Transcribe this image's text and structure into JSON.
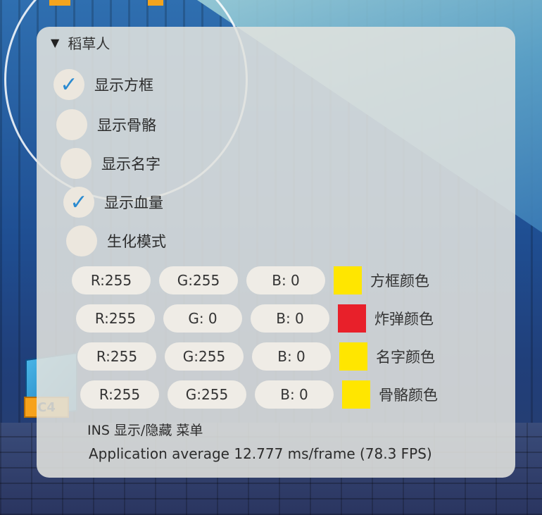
{
  "background": {
    "bomb_site_label": "C4"
  },
  "menu": {
    "header": {
      "toggle_glyph": "▼",
      "title": "稻草人"
    },
    "checkboxes": [
      {
        "label": "显示方框",
        "checked": true,
        "check_glyph": "✓"
      },
      {
        "label": "显示骨骼",
        "checked": false,
        "check_glyph": ""
      },
      {
        "label": "显示名字",
        "checked": false,
        "check_glyph": ""
      },
      {
        "label": "显示血量",
        "checked": true,
        "check_glyph": "✓"
      },
      {
        "label": "生化模式",
        "checked": false,
        "check_glyph": ""
      }
    ],
    "color_rows": [
      {
        "r": "R:255",
        "g": "G:255",
        "b": "B:  0",
        "swatch": "#ffe600",
        "label": "方框颜色"
      },
      {
        "r": "R:255",
        "g": "G:  0",
        "b": "B:  0",
        "swatch": "#e8202a",
        "label": "炸弹颜色"
      },
      {
        "r": "R:255",
        "g": "G:255",
        "b": "B:  0",
        "swatch": "#ffe600",
        "label": "名字颜色"
      },
      {
        "r": "R:255",
        "g": "G:255",
        "b": "B:  0",
        "swatch": "#ffe600",
        "label": "骨骼颜色"
      }
    ],
    "hotkey_hint": "INS 显示/隐藏 菜单",
    "fps_text": "Application average 12.777 ms/frame (78.3 FPS)"
  },
  "colors": {
    "check_accent": "#2a8ad0",
    "panel_bg": "#e1e2de"
  }
}
